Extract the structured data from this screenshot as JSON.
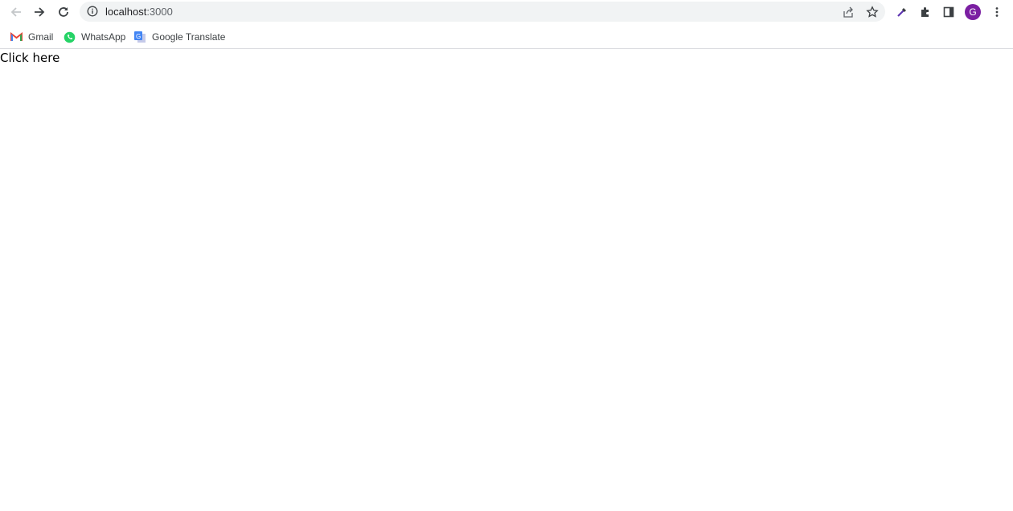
{
  "browser": {
    "address_bar": {
      "host": "localhost",
      "port": ":3000"
    },
    "icons": {
      "back": "arrow-left-icon",
      "forward": "arrow-right-icon",
      "reload": "reload-icon",
      "site_info": "info-icon",
      "share": "share-icon",
      "bookmark": "star-icon",
      "eyedropper": "eyedropper-icon",
      "extensions": "puzzle-icon",
      "side_panel": "side-panel-icon",
      "menu": "kebab-menu-icon"
    },
    "profile": {
      "initial": "G",
      "color": "#7b1fa2"
    }
  },
  "bookmarks": [
    {
      "label": "Gmail",
      "icon": "gmail-icon"
    },
    {
      "label": "WhatsApp",
      "icon": "whatsapp-icon"
    },
    {
      "label": "Google Translate",
      "icon": "google-translate-icon"
    }
  ],
  "page": {
    "link_text": "Click here"
  }
}
